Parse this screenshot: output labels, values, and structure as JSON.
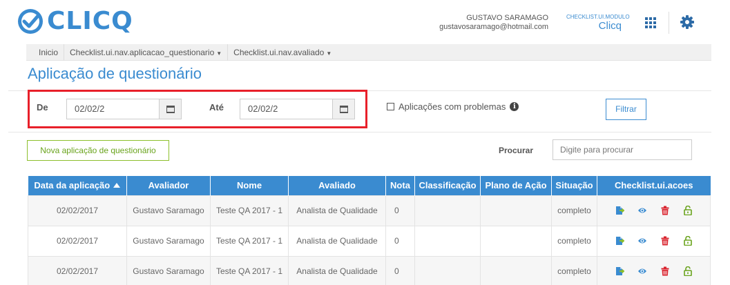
{
  "colors": {
    "brand": "#3a8bd0",
    "danger_outline": "#e8202a",
    "success": "#8cbf2b",
    "delete": "#d9232d"
  },
  "header": {
    "logo_text": "CLICQ",
    "user_name": "GUSTAVO SARAMAGO",
    "user_email": "gustavosaramago@hotmail.com",
    "module_label": "CHECKLIST.UI.MODULO",
    "module_value": "Clicq",
    "icons": [
      "apps-grid-icon",
      "gear-icon"
    ]
  },
  "nav": {
    "items": [
      {
        "label": "Inicio"
      },
      {
        "label": "Checklist.ui.nav.aplicacao_questionario"
      },
      {
        "label": "Checklist.ui.nav.avaliado"
      }
    ]
  },
  "page": {
    "title": "Aplicação de questionário"
  },
  "filter": {
    "from_label": "De",
    "from_value": "02/02/2",
    "to_label": "Até",
    "to_value": "02/02/2",
    "problems_label": "Aplicações com problemas",
    "problems_checked": false,
    "submit_label": "Filtrar"
  },
  "actions": {
    "new_label": "Nova aplicação de questionário",
    "search_label": "Procurar",
    "search_placeholder": "Digite para procurar"
  },
  "table": {
    "columns": [
      "Data da aplicação",
      "Avaliador",
      "Nome",
      "Avaliado",
      "Nota",
      "Classificação",
      "Plano de Ação",
      "Situação",
      "Checklist.ui.acoes"
    ],
    "sorted_column": "Data da aplicação",
    "sort_direction": "asc",
    "row_actions": [
      "export-icon",
      "view-icon",
      "delete-icon",
      "unlock-icon"
    ],
    "rows": [
      {
        "data": "02/02/2017",
        "avaliador": "Gustavo Saramago",
        "nome": "Teste QA 2017 - 1",
        "avaliado": "Analista de Qualidade",
        "nota": "0",
        "classificacao": "",
        "plano": "",
        "situacao": "completo"
      },
      {
        "data": "02/02/2017",
        "avaliador": "Gustavo Saramago",
        "nome": "Teste QA 2017 - 1",
        "avaliado": "Analista de Qualidade",
        "nota": "0",
        "classificacao": "",
        "plano": "",
        "situacao": "completo"
      },
      {
        "data": "02/02/2017",
        "avaliador": "Gustavo Saramago",
        "nome": "Teste QA 2017 - 1",
        "avaliado": "Analista de Qualidade",
        "nota": "0",
        "classificacao": "",
        "plano": "",
        "situacao": "completo"
      }
    ]
  }
}
